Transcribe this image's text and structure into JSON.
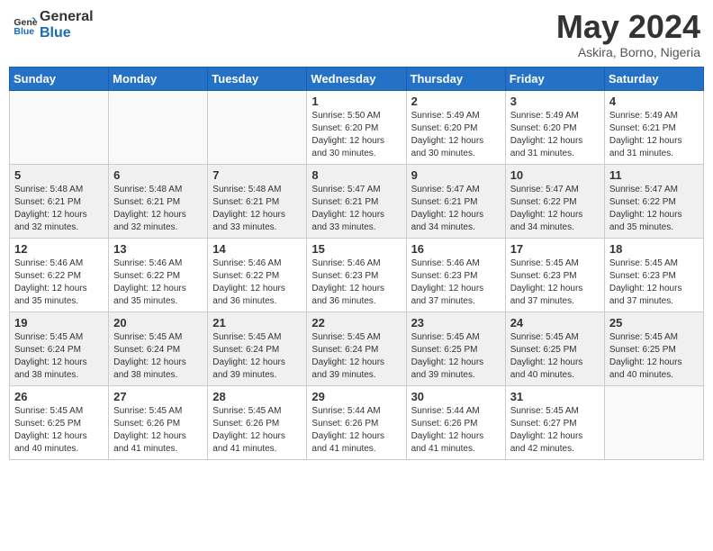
{
  "logo": {
    "line1": "General",
    "line2": "Blue"
  },
  "title": "May 2024",
  "location": "Askira, Borno, Nigeria",
  "weekdays": [
    "Sunday",
    "Monday",
    "Tuesday",
    "Wednesday",
    "Thursday",
    "Friday",
    "Saturday"
  ],
  "weeks": [
    [
      {
        "day": "",
        "info": ""
      },
      {
        "day": "",
        "info": ""
      },
      {
        "day": "",
        "info": ""
      },
      {
        "day": "1",
        "info": "Sunrise: 5:50 AM\nSunset: 6:20 PM\nDaylight: 12 hours and 30 minutes."
      },
      {
        "day": "2",
        "info": "Sunrise: 5:49 AM\nSunset: 6:20 PM\nDaylight: 12 hours and 30 minutes."
      },
      {
        "day": "3",
        "info": "Sunrise: 5:49 AM\nSunset: 6:20 PM\nDaylight: 12 hours and 31 minutes."
      },
      {
        "day": "4",
        "info": "Sunrise: 5:49 AM\nSunset: 6:21 PM\nDaylight: 12 hours and 31 minutes."
      }
    ],
    [
      {
        "day": "5",
        "info": "Sunrise: 5:48 AM\nSunset: 6:21 PM\nDaylight: 12 hours and 32 minutes."
      },
      {
        "day": "6",
        "info": "Sunrise: 5:48 AM\nSunset: 6:21 PM\nDaylight: 12 hours and 32 minutes."
      },
      {
        "day": "7",
        "info": "Sunrise: 5:48 AM\nSunset: 6:21 PM\nDaylight: 12 hours and 33 minutes."
      },
      {
        "day": "8",
        "info": "Sunrise: 5:47 AM\nSunset: 6:21 PM\nDaylight: 12 hours and 33 minutes."
      },
      {
        "day": "9",
        "info": "Sunrise: 5:47 AM\nSunset: 6:21 PM\nDaylight: 12 hours and 34 minutes."
      },
      {
        "day": "10",
        "info": "Sunrise: 5:47 AM\nSunset: 6:22 PM\nDaylight: 12 hours and 34 minutes."
      },
      {
        "day": "11",
        "info": "Sunrise: 5:47 AM\nSunset: 6:22 PM\nDaylight: 12 hours and 35 minutes."
      }
    ],
    [
      {
        "day": "12",
        "info": "Sunrise: 5:46 AM\nSunset: 6:22 PM\nDaylight: 12 hours and 35 minutes."
      },
      {
        "day": "13",
        "info": "Sunrise: 5:46 AM\nSunset: 6:22 PM\nDaylight: 12 hours and 35 minutes."
      },
      {
        "day": "14",
        "info": "Sunrise: 5:46 AM\nSunset: 6:22 PM\nDaylight: 12 hours and 36 minutes."
      },
      {
        "day": "15",
        "info": "Sunrise: 5:46 AM\nSunset: 6:23 PM\nDaylight: 12 hours and 36 minutes."
      },
      {
        "day": "16",
        "info": "Sunrise: 5:46 AM\nSunset: 6:23 PM\nDaylight: 12 hours and 37 minutes."
      },
      {
        "day": "17",
        "info": "Sunrise: 5:45 AM\nSunset: 6:23 PM\nDaylight: 12 hours and 37 minutes."
      },
      {
        "day": "18",
        "info": "Sunrise: 5:45 AM\nSunset: 6:23 PM\nDaylight: 12 hours and 37 minutes."
      }
    ],
    [
      {
        "day": "19",
        "info": "Sunrise: 5:45 AM\nSunset: 6:24 PM\nDaylight: 12 hours and 38 minutes."
      },
      {
        "day": "20",
        "info": "Sunrise: 5:45 AM\nSunset: 6:24 PM\nDaylight: 12 hours and 38 minutes."
      },
      {
        "day": "21",
        "info": "Sunrise: 5:45 AM\nSunset: 6:24 PM\nDaylight: 12 hours and 39 minutes."
      },
      {
        "day": "22",
        "info": "Sunrise: 5:45 AM\nSunset: 6:24 PM\nDaylight: 12 hours and 39 minutes."
      },
      {
        "day": "23",
        "info": "Sunrise: 5:45 AM\nSunset: 6:25 PM\nDaylight: 12 hours and 39 minutes."
      },
      {
        "day": "24",
        "info": "Sunrise: 5:45 AM\nSunset: 6:25 PM\nDaylight: 12 hours and 40 minutes."
      },
      {
        "day": "25",
        "info": "Sunrise: 5:45 AM\nSunset: 6:25 PM\nDaylight: 12 hours and 40 minutes."
      }
    ],
    [
      {
        "day": "26",
        "info": "Sunrise: 5:45 AM\nSunset: 6:25 PM\nDaylight: 12 hours and 40 minutes."
      },
      {
        "day": "27",
        "info": "Sunrise: 5:45 AM\nSunset: 6:26 PM\nDaylight: 12 hours and 41 minutes."
      },
      {
        "day": "28",
        "info": "Sunrise: 5:45 AM\nSunset: 6:26 PM\nDaylight: 12 hours and 41 minutes."
      },
      {
        "day": "29",
        "info": "Sunrise: 5:44 AM\nSunset: 6:26 PM\nDaylight: 12 hours and 41 minutes."
      },
      {
        "day": "30",
        "info": "Sunrise: 5:44 AM\nSunset: 6:26 PM\nDaylight: 12 hours and 41 minutes."
      },
      {
        "day": "31",
        "info": "Sunrise: 5:45 AM\nSunset: 6:27 PM\nDaylight: 12 hours and 42 minutes."
      },
      {
        "day": "",
        "info": ""
      }
    ]
  ]
}
